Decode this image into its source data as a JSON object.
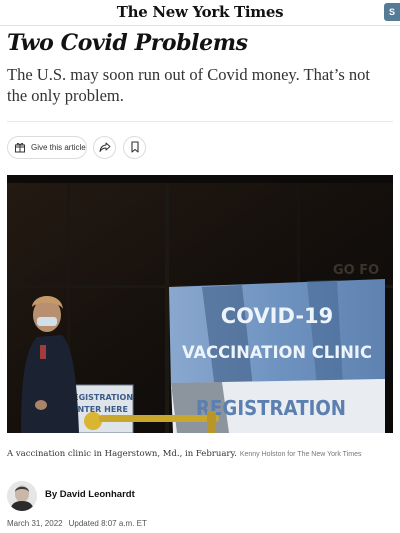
{
  "header": {
    "logo_text": "The New York Times",
    "subscribe_label": "S"
  },
  "article": {
    "headline": "Two Covid Problems",
    "summary": "The U.S. may soon run out of Covid money. That’s not the only problem."
  },
  "share_bar": {
    "gift_label": "Give this article",
    "icons": [
      "gift-icon",
      "share-icon",
      "bookmark-icon"
    ]
  },
  "photo": {
    "signs": {
      "banner_line1": "COVID-19",
      "banner_line2": "VACCINATION CLINIC",
      "banner_line3": "REGISTRATION",
      "small_sign_line1": "REGISTRATION",
      "small_sign_line2": "ENTER HERE",
      "window_text": "GO FO"
    },
    "caption": "A vaccination clinic in Hagerstown, Md., in February.",
    "credit": "Kenny Holston for The New York Times"
  },
  "author": {
    "byline": "By David Leonhardt"
  },
  "meta": {
    "date": "March 31, 2022",
    "updated": "Updated 8:07 a.m. ET"
  },
  "colors": {
    "banner_blue": "#6f93c0",
    "subscribe_blue": "#567b95",
    "text": "#121212"
  }
}
